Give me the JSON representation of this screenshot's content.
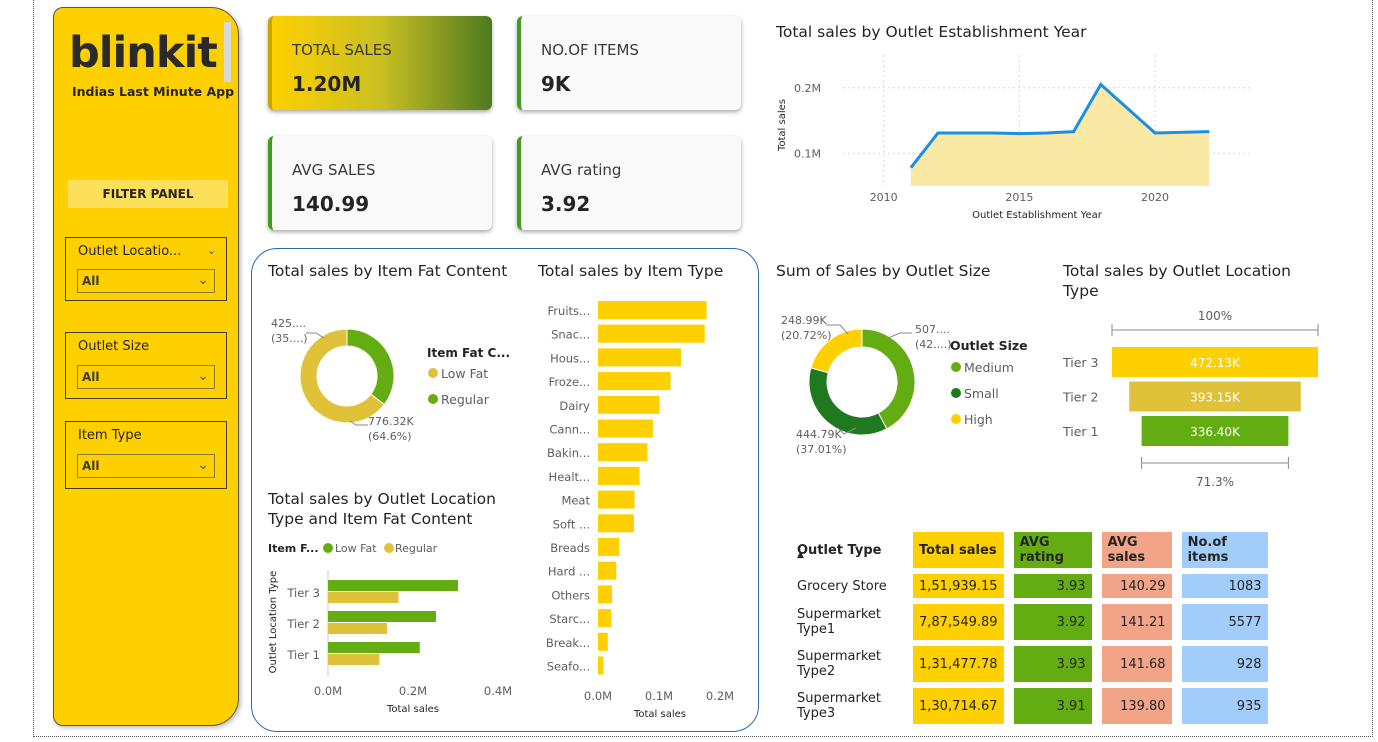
{
  "sidebar": {
    "logo": "blinkit",
    "tagline": "Indias Last Minute App",
    "filter_title": "FILTER PANEL",
    "slicers": [
      {
        "title": "Outlet Locatio...",
        "value": "All"
      },
      {
        "title": "Outlet Size",
        "value": "All"
      },
      {
        "title": "Item Type",
        "value": "All"
      }
    ]
  },
  "kpis": [
    {
      "label": "TOTAL SALES",
      "value": "1.20M"
    },
    {
      "label": "NO.OF ITEMS",
      "value": "9K"
    },
    {
      "label": "AVG SALES",
      "value": "140.99"
    },
    {
      "label": "AVG rating",
      "value": "3.92"
    }
  ],
  "colors": {
    "yellow": "#fed000",
    "green": "#63ad13",
    "dark_green": "#1f7a1f",
    "gold": "#e0c23a",
    "salmon": "#f1a488",
    "blue": "#a2cdfa",
    "line_blue": "#1d8fe0"
  },
  "chart_data": [
    {
      "type": "area",
      "title": "Total sales by Outlet Establishment Year",
      "xlabel": "Outlet Establishment Year",
      "ylabel": "Total sales",
      "x": [
        2011,
        2012,
        2014,
        2015,
        2016,
        2017,
        2018,
        2020,
        2022
      ],
      "values": [
        0.078,
        0.131,
        0.131,
        0.13,
        0.131,
        0.133,
        0.205,
        0.131,
        0.133
      ],
      "x_ticks": [
        "2010",
        "2015",
        "2020"
      ],
      "y_ticks": [
        "0.1M",
        "0.2M"
      ],
      "xlim": [
        2008.5,
        2023.5
      ],
      "ylim": [
        0.05,
        0.25
      ],
      "grid": true
    },
    {
      "type": "pie",
      "title": "Total sales by Item Fat Content",
      "legend_title": "Item Fat C...",
      "categories": [
        "Low Fat",
        "Regular"
      ],
      "values": [
        776.32,
        425.36
      ],
      "value_labels": [
        "776.32K\n(64.6%)",
        "425....\n(35....)"
      ],
      "legend_position": "right"
    },
    {
      "type": "bar",
      "title": "Total sales by Item Type",
      "xlabel": "Total sales",
      "categories": [
        "Fruits...",
        "Snac...",
        "Hous...",
        "Froze...",
        "Dairy",
        "Cann...",
        "Bakin...",
        "Healt...",
        "Meat",
        "Soft ...",
        "Breads",
        "Hard ...",
        "Others",
        "Starc...",
        "Break...",
        "Seafo..."
      ],
      "values": [
        0.178,
        0.175,
        0.136,
        0.119,
        0.101,
        0.09,
        0.081,
        0.068,
        0.06,
        0.059,
        0.035,
        0.03,
        0.023,
        0.022,
        0.016,
        0.009
      ],
      "x_ticks": [
        "0.0M",
        "0.1M",
        "0.2M"
      ],
      "xlim": [
        0,
        0.2
      ]
    },
    {
      "type": "bar",
      "title": "Total sales by Outlet Location Type and Item Fat Content",
      "legend_title": "Item F...",
      "xlabel": "Total sales",
      "ylabel": "Outlet Location Type",
      "categories": [
        "Tier 3",
        "Tier 2",
        "Tier 1"
      ],
      "series": [
        {
          "name": "Low Fat",
          "values": [
            0.306,
            0.254,
            0.216
          ]
        },
        {
          "name": "Regular",
          "values": [
            0.166,
            0.139,
            0.121
          ]
        }
      ],
      "x_ticks": [
        "0.0M",
        "0.2M",
        "0.4M"
      ],
      "xlim": [
        0,
        0.4
      ]
    },
    {
      "type": "pie",
      "title": "Sum of Sales by Outlet Size",
      "legend_title": "Outlet Size",
      "categories": [
        "Medium",
        "Small",
        "High"
      ],
      "values": [
        507.9,
        444.79,
        248.99
      ],
      "value_labels": [
        "507....\n(42....)",
        "444.79K\n(37.01%)",
        "248.99K\n(20.72%)"
      ],
      "legend_position": "right"
    },
    {
      "type": "bar",
      "title": "Total sales by Outlet Location Type",
      "categories": [
        "Tier 3",
        "Tier 2",
        "Tier 1"
      ],
      "values": [
        472.13,
        393.15,
        336.4
      ],
      "value_labels": [
        "472.13K",
        "393.15K",
        "336.40K"
      ],
      "top_percent": "100%",
      "bottom_percent": "71.3%"
    }
  ],
  "table": {
    "headers": [
      "Outlet Type",
      "Total sales",
      "AVG rating",
      "AVG sales",
      "No.of items"
    ],
    "rows": [
      [
        "Grocery Store",
        "1,51,939.15",
        "3.93",
        "140.29",
        "1083"
      ],
      [
        "Supermarket Type1",
        "7,87,549.89",
        "3.92",
        "141.21",
        "5577"
      ],
      [
        "Supermarket Type2",
        "1,31,477.78",
        "3.93",
        "141.68",
        "928"
      ],
      [
        "Supermarket Type3",
        "1,30,714.67",
        "3.91",
        "139.80",
        "935"
      ]
    ]
  }
}
